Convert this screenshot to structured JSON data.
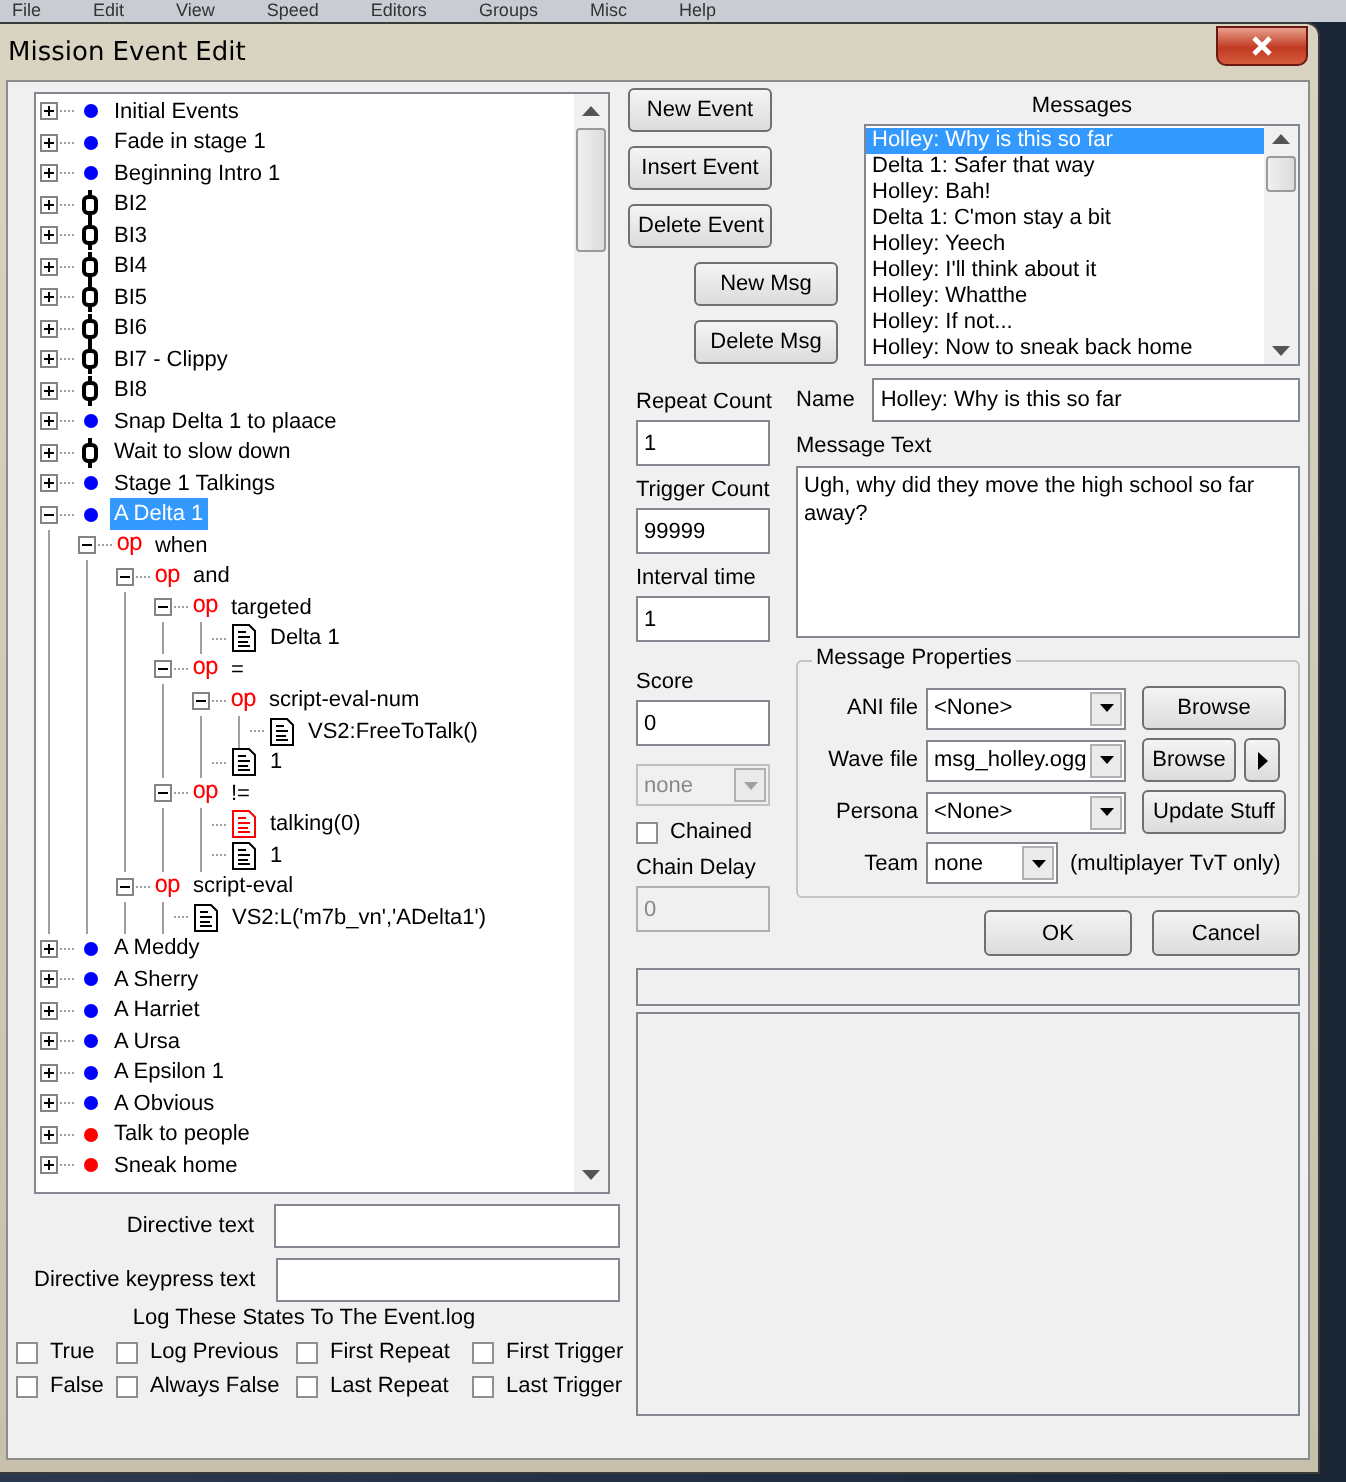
{
  "menu_bar": [
    "File",
    "Edit",
    "View",
    "Speed",
    "Editors",
    "Groups",
    "Misc",
    "Help"
  ],
  "window": {
    "title": "Mission Event Edit"
  },
  "event_tree": [
    {
      "kind": "event",
      "color": "#0000ff",
      "label": "Initial Events",
      "expanded": false,
      "selected": false
    },
    {
      "kind": "event",
      "color": "#0000ff",
      "label": "Fade in stage 1",
      "expanded": false,
      "selected": false
    },
    {
      "kind": "event",
      "color": "#0000ff",
      "label": "Beginning Intro 1",
      "expanded": false,
      "selected": false
    },
    {
      "kind": "chain",
      "label": "BI2",
      "expanded": false,
      "selected": false
    },
    {
      "kind": "chain",
      "label": "BI3",
      "expanded": false,
      "selected": false
    },
    {
      "kind": "chain",
      "label": "BI4",
      "expanded": false,
      "selected": false
    },
    {
      "kind": "chain",
      "label": "BI5",
      "expanded": false,
      "selected": false
    },
    {
      "kind": "chain",
      "label": "BI6",
      "expanded": false,
      "selected": false
    },
    {
      "kind": "chain",
      "label": "BI7 - Clippy",
      "expanded": false,
      "selected": false
    },
    {
      "kind": "chain",
      "label": "BI8",
      "expanded": false,
      "selected": false
    },
    {
      "kind": "event",
      "color": "#0000ff",
      "label": "Snap Delta 1 to plaace",
      "expanded": false,
      "selected": false
    },
    {
      "kind": "chain",
      "label": "Wait to slow down",
      "expanded": false,
      "selected": false
    },
    {
      "kind": "event",
      "color": "#0000ff",
      "label": "Stage 1 Talkings",
      "expanded": false,
      "selected": false
    },
    {
      "kind": "event",
      "color": "#0000ff",
      "label": "A Delta 1",
      "expanded": true,
      "selected": true,
      "children": [
        {
          "kind": "op",
          "tag": "op",
          "label": "when",
          "expanded": true,
          "selected": false,
          "children": [
            {
              "kind": "op",
              "tag": "op",
              "label": "and",
              "expanded": true,
              "selected": false,
              "children": [
                {
                  "kind": "op",
                  "tag": "op",
                  "label": "targeted",
                  "expanded": true,
                  "selected": false,
                  "children": [
                    {
                      "kind": "value",
                      "color": "#000000",
                      "label": "Delta 1",
                      "selected": false
                    }
                  ]
                },
                {
                  "kind": "op",
                  "tag": "op",
                  "label": "=",
                  "expanded": true,
                  "selected": false,
                  "children": [
                    {
                      "kind": "op",
                      "tag": "op",
                      "label": "script-eval-num",
                      "expanded": true,
                      "selected": false,
                      "children": [
                        {
                          "kind": "value",
                          "color": "#000000",
                          "label": "VS2:FreeToTalk()",
                          "selected": false
                        }
                      ]
                    },
                    {
                      "kind": "value",
                      "color": "#000000",
                      "label": "1",
                      "selected": false
                    }
                  ]
                },
                {
                  "kind": "op",
                  "tag": "op",
                  "label": "!=",
                  "expanded": true,
                  "selected": false,
                  "children": [
                    {
                      "kind": "value",
                      "color": "#ff0000",
                      "label": "talking(0)",
                      "selected": false
                    },
                    {
                      "kind": "value",
                      "color": "#000000",
                      "label": "1",
                      "selected": false
                    }
                  ]
                }
              ]
            },
            {
              "kind": "op",
              "tag": "op",
              "label": "script-eval",
              "expanded": true,
              "selected": false,
              "children": [
                {
                  "kind": "value",
                  "color": "#000000",
                  "label": "VS2:L('m7b_vn','ADelta1')",
                  "selected": false
                }
              ]
            }
          ]
        }
      ]
    },
    {
      "kind": "event",
      "color": "#0000ff",
      "label": "A Meddy",
      "expanded": false,
      "selected": false
    },
    {
      "kind": "event",
      "color": "#0000ff",
      "label": "A Sherry",
      "expanded": false,
      "selected": false
    },
    {
      "kind": "event",
      "color": "#0000ff",
      "label": "A Harriet",
      "expanded": false,
      "selected": false
    },
    {
      "kind": "event",
      "color": "#0000ff",
      "label": "A Ursa",
      "expanded": false,
      "selected": false
    },
    {
      "kind": "event",
      "color": "#0000ff",
      "label": "A Epsilon 1",
      "expanded": false,
      "selected": false
    },
    {
      "kind": "event",
      "color": "#0000ff",
      "label": "A Obvious",
      "expanded": false,
      "selected": false
    },
    {
      "kind": "event",
      "color": "#ff0000",
      "label": "Talk to people",
      "expanded": false,
      "selected": false
    },
    {
      "kind": "event",
      "color": "#ff0000",
      "label": "Sneak home",
      "expanded": false,
      "selected": false
    }
  ],
  "event_buttons": [
    "New Event",
    "Insert Event",
    "Delete Event"
  ],
  "message_buttons": [
    "New Msg",
    "Delete Msg"
  ],
  "messages": {
    "label": "Messages",
    "items": [
      {
        "text": "Holley: Why is this so far",
        "selected": true
      },
      {
        "text": "Delta 1: Safer that way",
        "selected": false
      },
      {
        "text": "Holley: Bah!",
        "selected": false
      },
      {
        "text": "Delta 1: C'mon stay a bit",
        "selected": false
      },
      {
        "text": "Holley: Yeech",
        "selected": false
      },
      {
        "text": "Holley: I'll think about it",
        "selected": false
      },
      {
        "text": "Holley: Whatthe",
        "selected": false
      },
      {
        "text": "Holley: If not...",
        "selected": false
      },
      {
        "text": "Holley: Now to sneak back home",
        "selected": false
      }
    ]
  },
  "event_fields": [
    {
      "label": "Repeat Count",
      "value": "1"
    },
    {
      "label": "Trigger Count",
      "value": "99999"
    },
    {
      "label": "Interval time",
      "value": "1"
    },
    {
      "label": "Score",
      "value": "0"
    }
  ],
  "team_select": {
    "value": "none",
    "disabled": true
  },
  "chained": {
    "label": "Chained",
    "checked": false
  },
  "chain_delay": {
    "label": "Chain Delay",
    "value": "0",
    "disabled": true
  },
  "message": {
    "name_label": "Name",
    "name": "Holley: Why is this so far",
    "text_label": "Message Text",
    "text": "Ugh, why did they move the high school so far away?"
  },
  "message_properties": {
    "title": "Message Properties",
    "rows": [
      {
        "label": "ANI file",
        "value": "<None>",
        "button": "Browse"
      },
      {
        "label": "Wave file",
        "value": "msg_holley.ogg",
        "button": "Browse",
        "play": true
      },
      {
        "label": "Persona",
        "value": "<None>",
        "button": "Update Stuff"
      },
      {
        "label": "Team",
        "value": "none",
        "note": "(multiplayer TvT only)"
      }
    ]
  },
  "dialog_buttons": [
    "OK",
    "Cancel"
  ],
  "directive_fields": [
    {
      "label": "Directive text"
    },
    {
      "label": "Directive keypress text"
    }
  ],
  "log_states": {
    "title": "Log These States To The Event.log",
    "options": [
      {
        "label": "True",
        "checked": false
      },
      {
        "label": "Log Previous",
        "checked": false
      },
      {
        "label": "First Repeat",
        "checked": false
      },
      {
        "label": "First Trigger",
        "checked": false
      },
      {
        "label": "False",
        "checked": false
      },
      {
        "label": "Always False",
        "checked": false
      },
      {
        "label": "Last Repeat",
        "checked": false
      },
      {
        "label": "Last Trigger",
        "checked": false
      }
    ]
  }
}
